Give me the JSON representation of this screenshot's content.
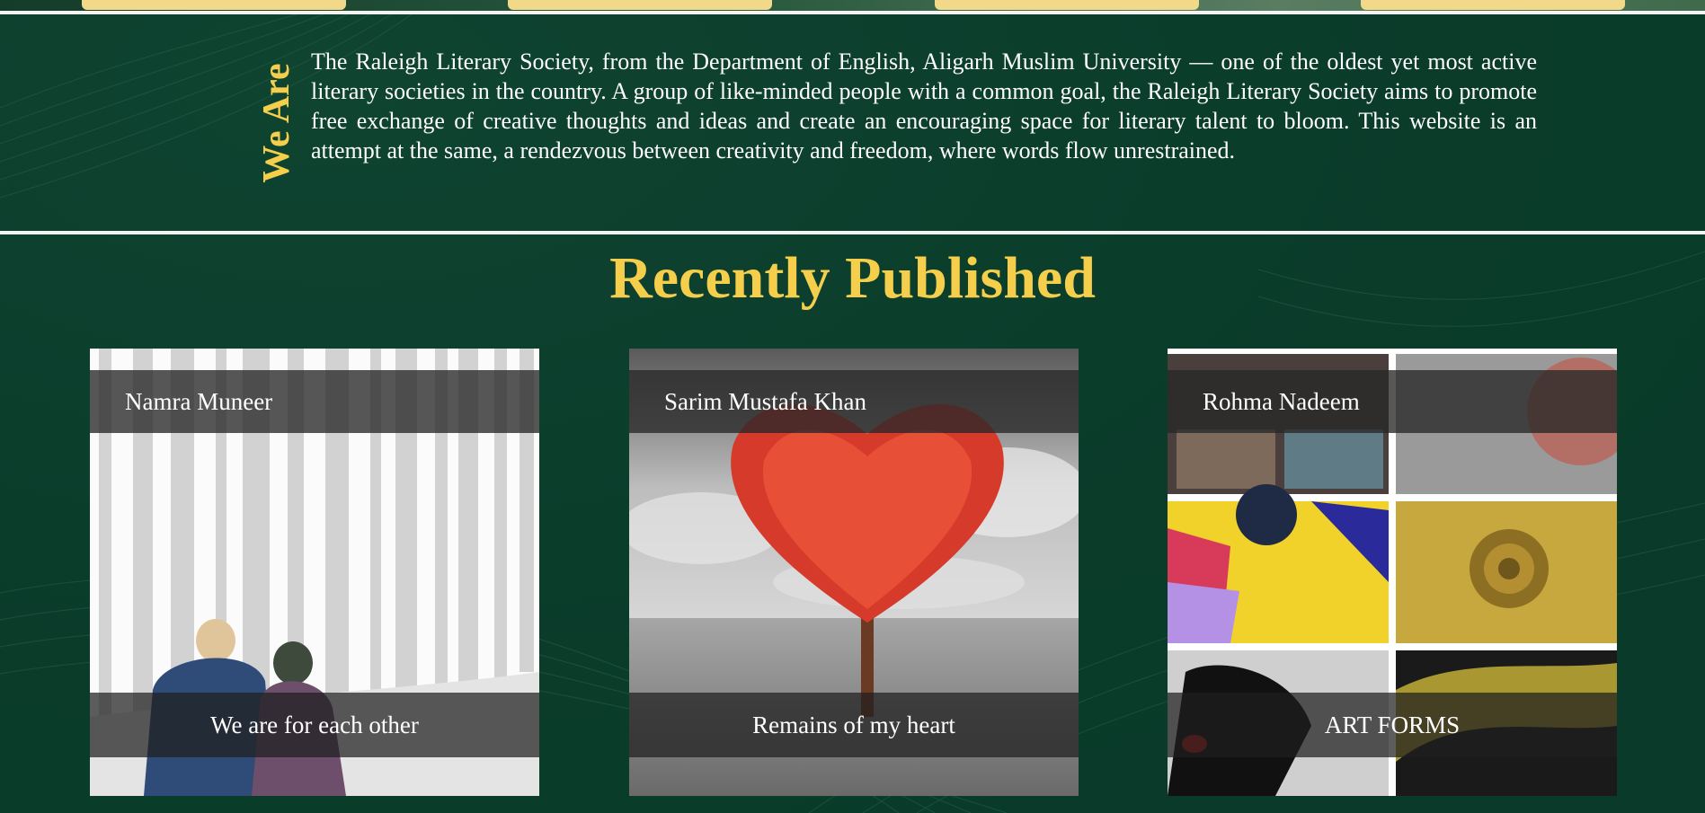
{
  "theme": {
    "background": "#0b3d2b",
    "accent": "#f5cf4c",
    "tab_color": "#f2d98a",
    "text": "#ffffff"
  },
  "about": {
    "heading": "We Are",
    "text": "The Raleigh Literary Society, from the Department of English, Aligarh Muslim University — one of the oldest yet most active literary societies in the country. A group of like-minded people with a common goal, the Raleigh Literary Society aims to promote free exchange of creative thoughts and ideas and create an encouraging space for literary talent to bloom. This website is an attempt at the same, a rendezvous between creativity and freedom, where words flow unrestrained."
  },
  "recent": {
    "title": "Recently Published",
    "posts": [
      {
        "author": "Namra Muneer",
        "title": "We are for each other",
        "image": "watercolor-couple-illustration"
      },
      {
        "author": "Sarim Mustafa Khan",
        "title": "Remains of my heart",
        "image": "red-heart-tree-photo"
      },
      {
        "author": "Rohma Nadeem",
        "title": "ART FORMS",
        "image": "art-collage-grid"
      }
    ]
  }
}
